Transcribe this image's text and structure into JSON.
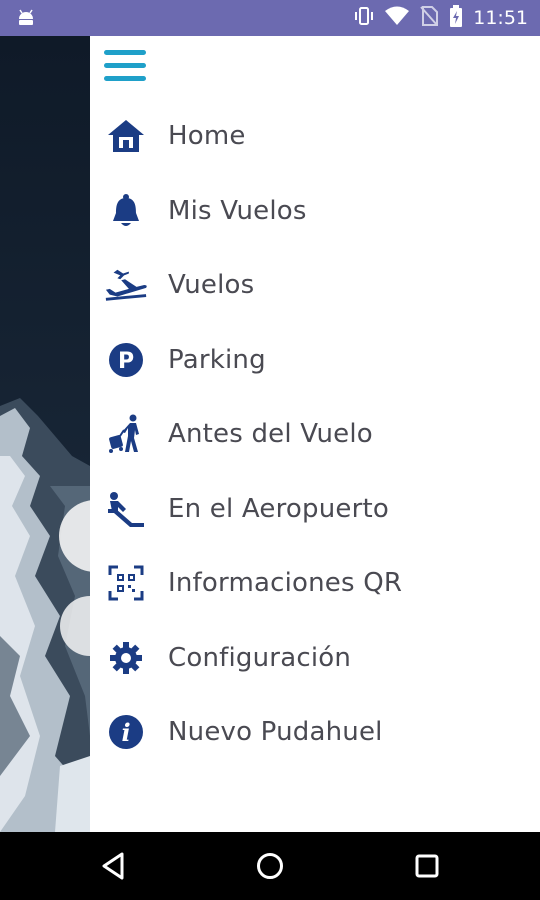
{
  "status_bar": {
    "time": "11:51"
  },
  "menu": {
    "items": [
      {
        "label": "Home",
        "icon": "home-icon"
      },
      {
        "label": "Mis Vuelos",
        "icon": "bell-icon"
      },
      {
        "label": "Vuelos",
        "icon": "airplane-icon"
      },
      {
        "label": "Parking",
        "icon": "parking-icon"
      },
      {
        "label": "Antes del Vuelo",
        "icon": "traveler-luggage-icon"
      },
      {
        "label": "En el Aeropuerto",
        "icon": "escalator-icon"
      },
      {
        "label": "Informaciones QR",
        "icon": "qr-code-icon"
      },
      {
        "label": "Configuración",
        "icon": "gear-icon"
      },
      {
        "label": "Nuevo Pudahuel",
        "icon": "info-icon"
      }
    ]
  },
  "colors": {
    "accent": "#1fa0c9",
    "icon": "#1b3c84",
    "status_bar": "#6c6ab0",
    "text": "#4a4a52"
  }
}
